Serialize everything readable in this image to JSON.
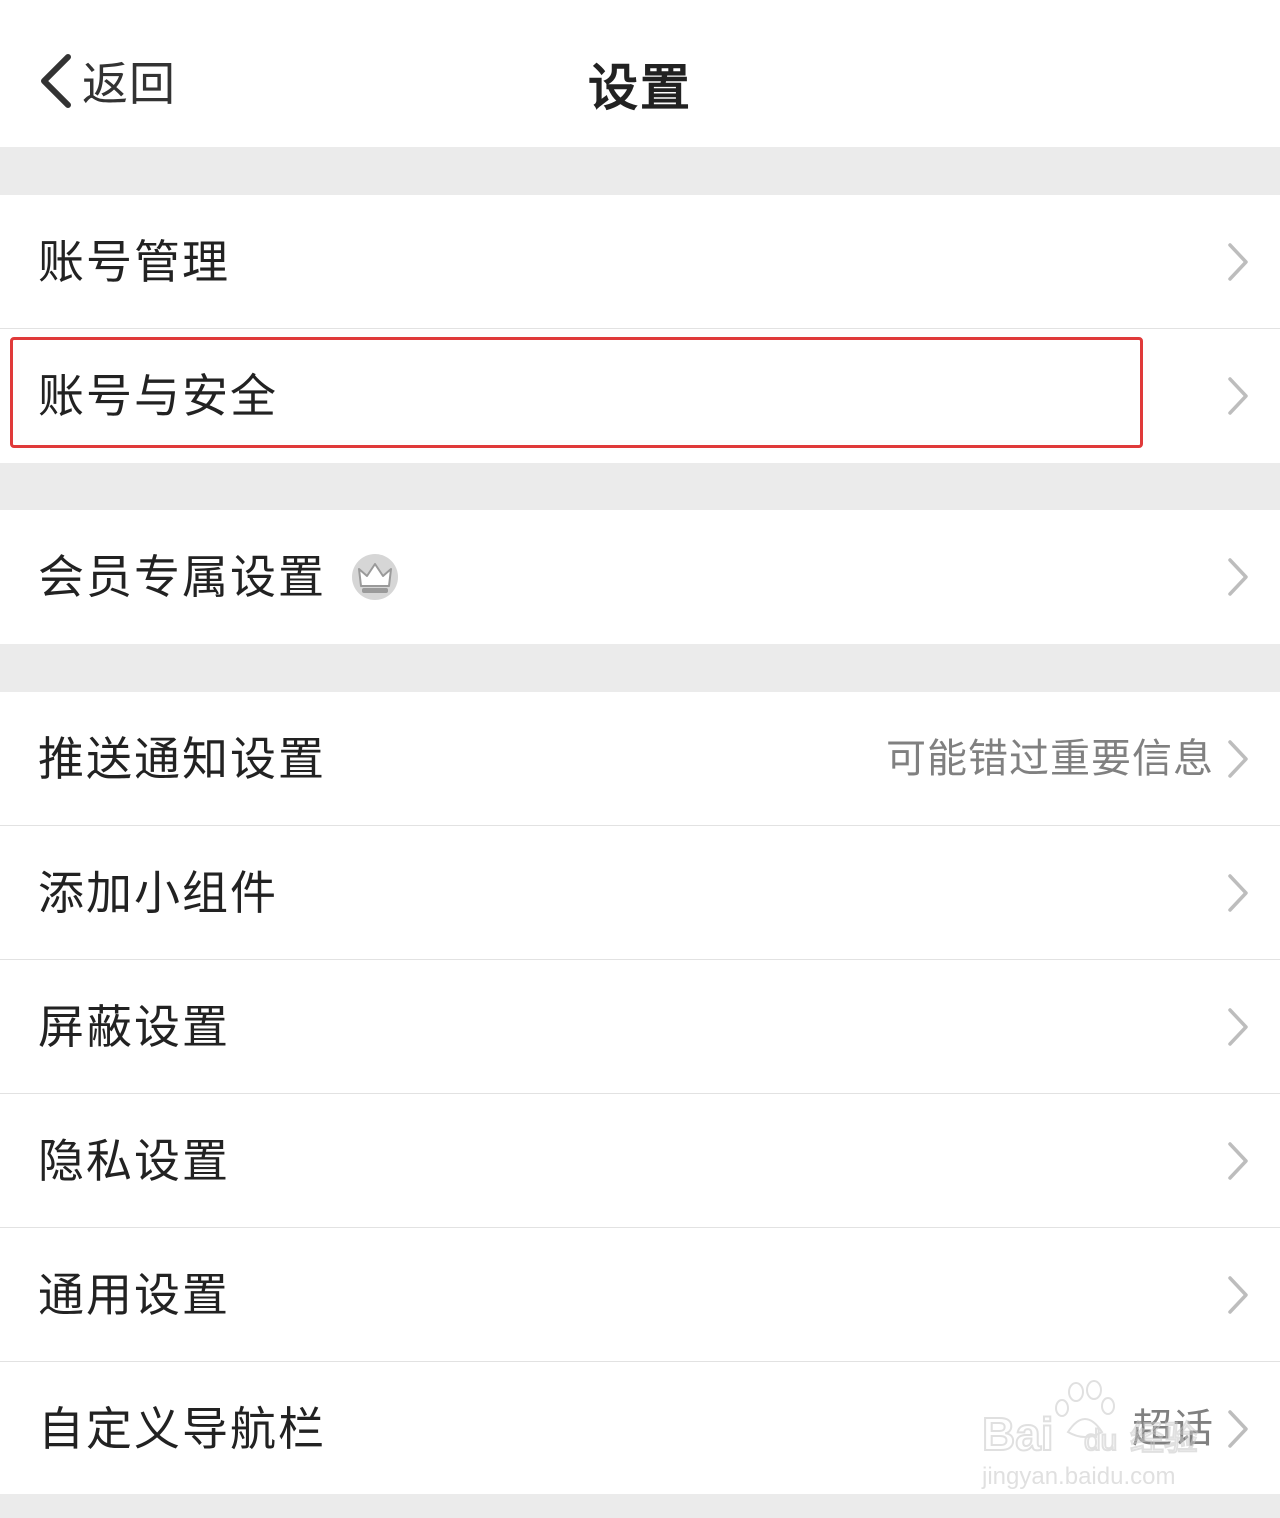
{
  "header": {
    "back_label": "返回",
    "title": "设置"
  },
  "rows": [
    {
      "label": "账号管理",
      "sub": ""
    },
    {
      "label": "账号与安全",
      "sub": ""
    },
    {
      "label": "会员专属设置",
      "sub": "",
      "icon": "crown-icon"
    },
    {
      "label": "推送通知设置",
      "sub": "可能错过重要信息"
    },
    {
      "label": "添加小组件",
      "sub": ""
    },
    {
      "label": "屏蔽设置",
      "sub": ""
    },
    {
      "label": "隐私设置",
      "sub": ""
    },
    {
      "label": "通用设置",
      "sub": ""
    },
    {
      "label": "自定义导航栏",
      "sub": "超话"
    }
  ],
  "watermark": {
    "brand": "Baidu经验",
    "url": "jingyan.baidu.com"
  },
  "colors": {
    "background": "#ebebeb",
    "row_background": "#ffffff",
    "highlight": "#e03a3a",
    "secondary_text": "#808080",
    "chevron": "#bdbdbd"
  }
}
